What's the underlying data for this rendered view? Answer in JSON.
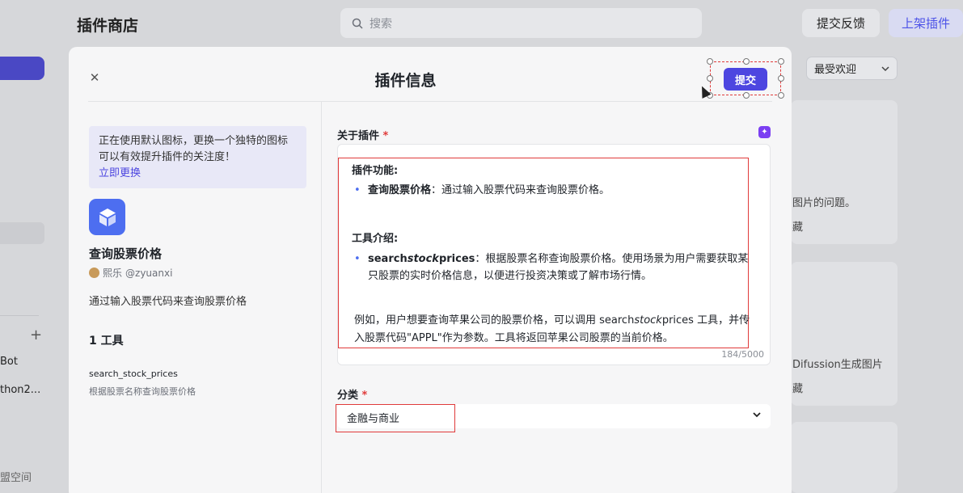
{
  "background": {
    "page_title": "插件商店",
    "search_placeholder": "搜索",
    "feedback_label": "提交反馈",
    "publish_label": "上架插件",
    "sort_label": "最受欢迎",
    "sidebar_items": [
      "Bot",
      "thon2..."
    ],
    "sidebar_footer": "盟空间",
    "card_texts": [
      "图片的问题。",
      "藏",
      "Difussion生成图片",
      "藏"
    ]
  },
  "modal": {
    "title": "插件信息",
    "submit_label": "提交",
    "close_icon": "close-icon"
  },
  "left": {
    "tip_text": "正在使用默认图标，更换一个独特的图标可以有效提升插件的关注度！",
    "tip_link": "立即更换",
    "plugin_name": "查询股票价格",
    "author_name": "熙乐",
    "author_handle": "@zyuanxi",
    "plugin_desc": "通过输入股票代码来查询股票价格",
    "tools_count": "1 工具",
    "tool_name": "search_stock_prices",
    "tool_desc": "根据股票名称查询股票价格"
  },
  "about": {
    "label": "关于插件",
    "required_mark": "*",
    "function_heading": "插件功能:",
    "function_bold": "查询股票价格",
    "function_text": "：通过输入股票代码来查询股票价格。",
    "tool_heading": "工具介绍:",
    "tool_bold_1": "search",
    "tool_bold_italic": "stock",
    "tool_bold_2": "prices",
    "tool_text": "：根据股票名称查询股票价格。使用场景为用户需要获取某只股票的实时价格信息，以便进行投资决策或了解市场行情。",
    "example_text_1": "例如，用户想要查询苹果公司的股票价格，可以调用 search",
    "example_italic": "stock",
    "example_text_2": "prices 工具，并传入股票代码\"APPL\"作为参数。工具将返回苹果公司股票的当前价格。",
    "counter": "184/5000"
  },
  "category": {
    "label": "分类",
    "required_mark": "*",
    "value": "金融与商业"
  },
  "colors": {
    "accent": "#4d46e0",
    "highlight_red": "#e03a3a"
  }
}
